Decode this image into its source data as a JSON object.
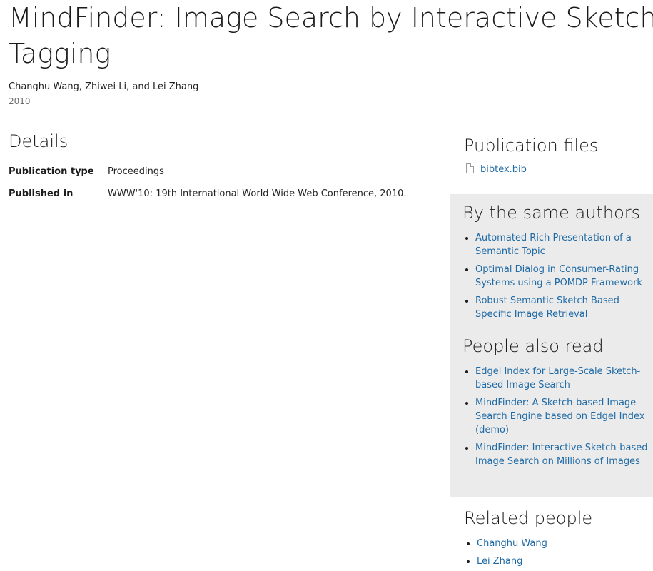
{
  "publication": {
    "title_line1": "MindFinder: Image Search by Interactive Sketching and",
    "title_line2": "Tagging",
    "authors": "Changhu Wang, Zhiwei Li, and Lei Zhang",
    "year": "2010"
  },
  "details": {
    "heading": "Details",
    "rows": [
      {
        "label": "Publication type",
        "value": "Proceedings"
      },
      {
        "label": "Published in",
        "value": "WWW'10: 19th International World Wide Web Conference, 2010."
      }
    ]
  },
  "files": {
    "heading": "Publication files",
    "items": [
      {
        "label": "bibtex.bib",
        "icon": "file-icon"
      }
    ]
  },
  "same_authors": {
    "heading": "By the same authors",
    "items": [
      {
        "label": "Automated Rich Presentation of a Semantic Topic"
      },
      {
        "label": "Optimal Dialog in Consumer-Rating Systems using a POMDP Framework"
      },
      {
        "label": "Robust Semantic Sketch Based Specific Image Retrieval"
      }
    ]
  },
  "also_read": {
    "heading": "People also read",
    "items": [
      {
        "label": "Edgel Index for Large-Scale Sketch-based Image Search"
      },
      {
        "label": "MindFinder: A Sketch-based Image Search Engine based on Edgel Index (demo)"
      },
      {
        "label": "MindFinder: Interactive Sketch-based Image Search on Millions of Images"
      }
    ]
  },
  "related_people": {
    "heading": "Related people",
    "items": [
      {
        "label": "Changhu Wang"
      },
      {
        "label": "Lei Zhang"
      }
    ]
  },
  "colors": {
    "link": "#1f6aa5",
    "panel_bg": "#ebebeb",
    "text": "#222222"
  }
}
